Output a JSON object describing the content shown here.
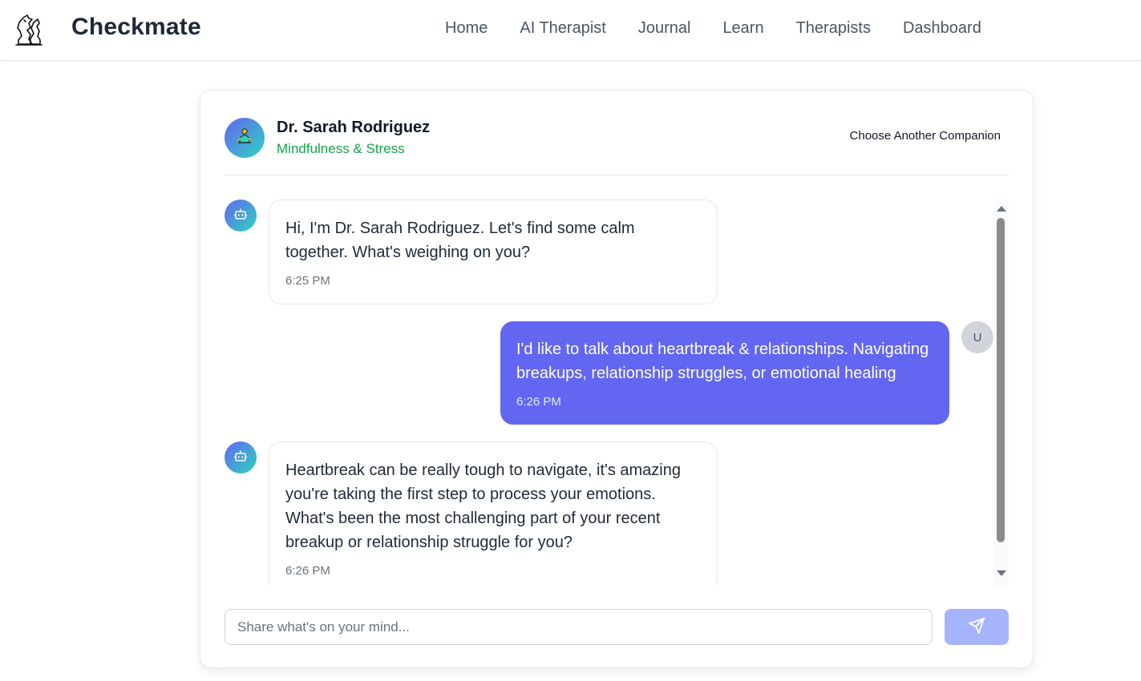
{
  "brand": {
    "name": "Checkmate",
    "logo_icon": "chess-knight-logo-icon"
  },
  "nav": {
    "items": [
      {
        "label": "Home"
      },
      {
        "label": "AI Therapist"
      },
      {
        "label": "Journal"
      },
      {
        "label": "Learn"
      },
      {
        "label": "Therapists"
      },
      {
        "label": "Dashboard"
      }
    ]
  },
  "companion": {
    "name": "Dr. Sarah Rodriguez",
    "specialty": "Mindfulness & Stress",
    "avatar_icon": "meditation-icon",
    "choose_label": "Choose Another Companion"
  },
  "messages": [
    {
      "role": "bot",
      "text": "Hi, I'm Dr. Sarah Rodriguez. Let's find some calm together. What's weighing on you?",
      "time": "6:25 PM"
    },
    {
      "role": "user",
      "avatar_initial": "U",
      "text": "I'd like to talk about heartbreak & relationships. Navigating breakups, relationship struggles, or emotional healing",
      "time": "6:26 PM"
    },
    {
      "role": "bot",
      "text": "Heartbreak can be really tough to navigate, it's amazing you're taking the first step to process your emotions. What's been the most challenging part of your recent breakup or relationship struggle for you?",
      "time": "6:26 PM"
    }
  ],
  "composer": {
    "placeholder": "Share what's on your mind...",
    "value": "",
    "send_icon": "send-icon"
  },
  "colors": {
    "accent": "#6366f1",
    "send_button": "#a5b4fc",
    "specialty": "#16a34a"
  }
}
